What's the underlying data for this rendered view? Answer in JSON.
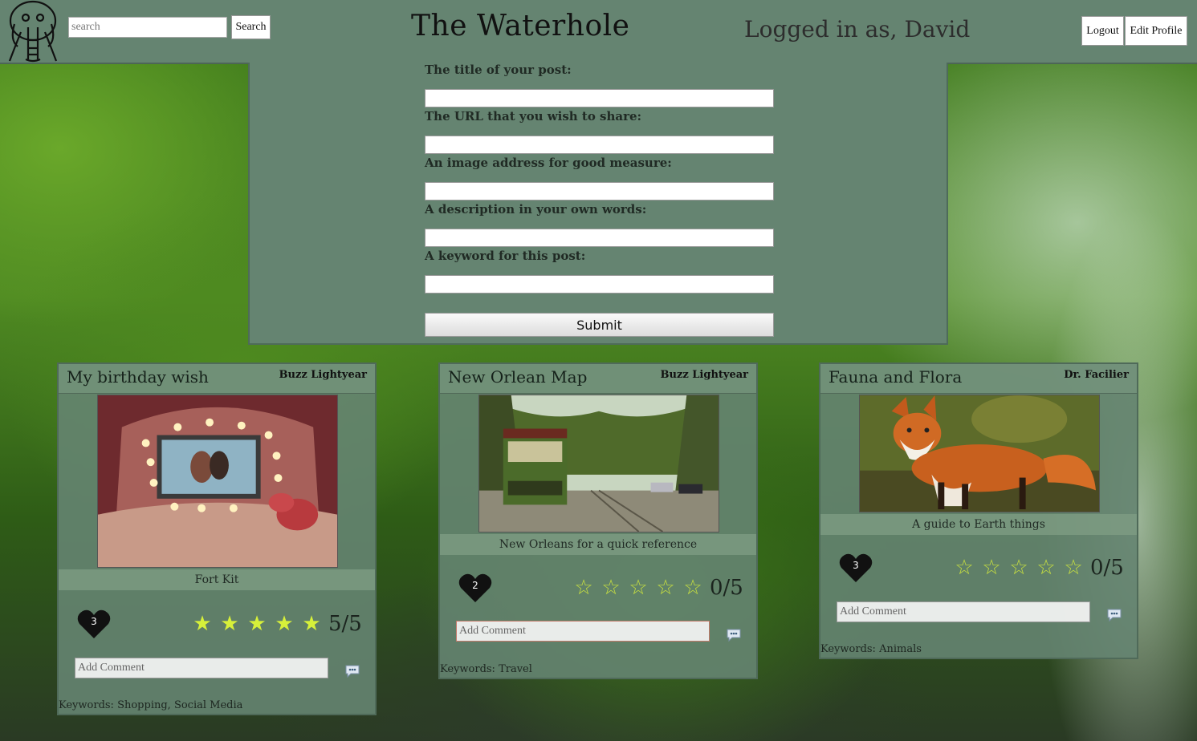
{
  "header": {
    "search_placeholder": "search",
    "search_button": "Search",
    "site_title": "The Waterhole",
    "logged_in_text": "Logged in as, David",
    "logout_button": "Logout",
    "edit_profile_button": "Edit Profile",
    "logo_icon": "elephant-icon"
  },
  "post_form": {
    "title_label": "The title of your post:",
    "url_label": "The URL that you wish to share:",
    "image_label": "An image address for good measure:",
    "description_label": "A description in your own words:",
    "keyword_label": "A keyword for this post:",
    "submit_label": "Submit"
  },
  "cards": [
    {
      "title": "My birthday wish",
      "author": "Buzz Lightyear",
      "description": "Fort Kit",
      "likes": "3",
      "rating": 5,
      "rating_text": "5/5",
      "comment_placeholder": "Add Comment",
      "keywords": "Keywords: Shopping, Social Media"
    },
    {
      "title": "New Orlean Map",
      "author": "Buzz Lightyear",
      "description": "New Orleans for a quick reference",
      "likes": "2",
      "rating": 0,
      "rating_text": "0/5",
      "comment_placeholder": "Add Comment",
      "keywords": "Keywords: Travel"
    },
    {
      "title": "Fauna and Flora",
      "author": "Dr. Facilier",
      "description": "A guide to Earth things",
      "likes": "3",
      "rating": 0,
      "rating_text": "0/5",
      "comment_placeholder": "Add Comment",
      "keywords": "Keywords: Animals"
    }
  ],
  "colors": {
    "panel": "#658471",
    "star": "#d7f03a"
  }
}
